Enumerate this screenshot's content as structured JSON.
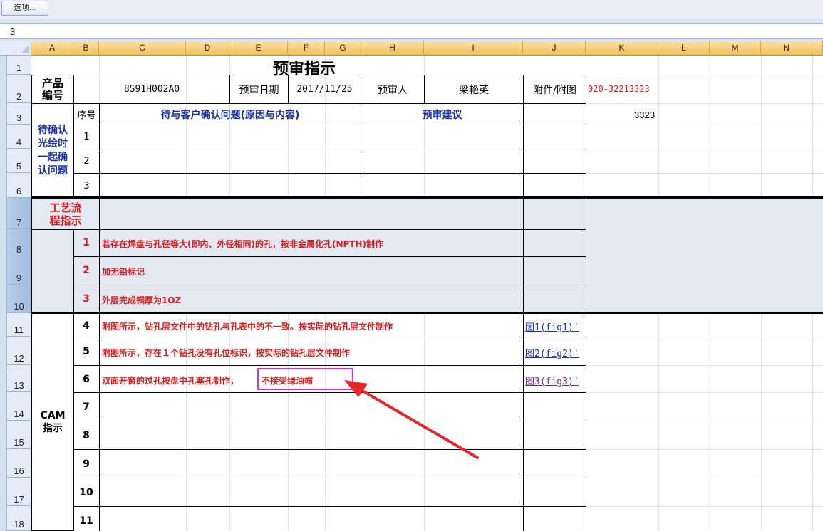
{
  "toolbar": {
    "options_button": "选项..."
  },
  "formula_bar": {
    "value": "3"
  },
  "columns": [
    "A",
    "B",
    "C",
    "D",
    "E",
    "F",
    "G",
    "H",
    "I",
    "J",
    "K",
    "L",
    "M",
    "N"
  ],
  "rows": [
    "1",
    "2",
    "3",
    "4",
    "5",
    "6",
    "7",
    "8",
    "9",
    "10",
    "11",
    "12",
    "13",
    "14",
    "15",
    "16",
    "17",
    "18"
  ],
  "sheet": {
    "title": "预审指示",
    "product_code_label": "产品编号",
    "product_code": "8S91H002A0",
    "review_date_label": "预审日期",
    "review_date": "2017/11/25",
    "reviewer_label": "预审人",
    "reviewer": "梁艳英",
    "attachment_label": "附件/附图",
    "phone": "020-32213323",
    "k3_value": "3323",
    "confirm": {
      "section_label": "待确认光绘时一起确认问题",
      "seq_header": "序号",
      "issue_header": "待与客户确认问题(原因与内容)",
      "suggestion_header": "预审建议",
      "items": [
        "1",
        "2",
        "3"
      ]
    },
    "process": {
      "section_label": "工艺流程指示",
      "items": [
        {
          "no": "1",
          "text": "若存在焊盘与孔径等大(即内、外径相同)的孔，按非金属化孔(NPTH)制作"
        },
        {
          "no": "2",
          "text": "加无铅标记"
        },
        {
          "no": "3",
          "text": "外层完成铜厚为1OZ"
        }
      ]
    },
    "cam": {
      "section_label": "CAM指示",
      "items": [
        {
          "no": "4",
          "text": "附图所示，钻孔层文件中的钻孔与孔表中的不一致。按实际的钻孔层文件制作",
          "link": "图1(fig1)'"
        },
        {
          "no": "5",
          "text": "附图所示，存在１个钻孔没有孔位标识，按实际的钻孔层文件制作",
          "link": "图2(fig2)'"
        },
        {
          "no": "6",
          "text": "双面开窗的过孔按盘中孔塞孔制作，",
          "highlight": "不接受绿油帽",
          "link": "图3(fig3)'"
        },
        {
          "no": "7"
        },
        {
          "no": "8"
        },
        {
          "no": "9"
        },
        {
          "no": "10"
        },
        {
          "no": "11"
        }
      ]
    }
  }
}
